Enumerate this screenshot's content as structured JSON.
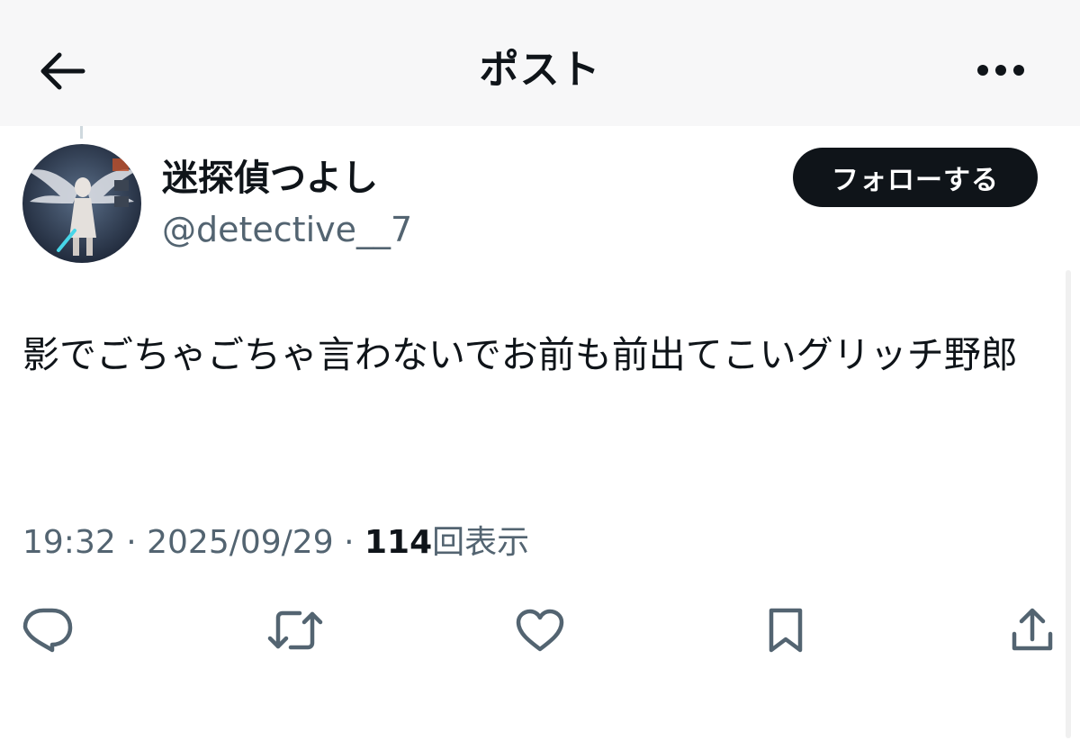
{
  "header": {
    "title": "ポスト",
    "back_icon": "arrow-left-icon",
    "more_icon": "more-horizontal-icon"
  },
  "author": {
    "display_name": "迷探偵つよし",
    "handle": "@detective__7",
    "follow_label": "フォローする"
  },
  "post": {
    "text": "影でごちゃごちゃ言わないでお前も前出てこいグリッチ野郎",
    "time": "19:32",
    "separator": "·",
    "date": "2025/09/29",
    "views_count": "114",
    "views_label": "回表示"
  },
  "actions": [
    {
      "name": "reply",
      "icon": "reply-icon"
    },
    {
      "name": "repost",
      "icon": "repost-icon"
    },
    {
      "name": "like",
      "icon": "heart-icon"
    },
    {
      "name": "bookmark",
      "icon": "bookmark-icon"
    },
    {
      "name": "share",
      "icon": "share-icon"
    }
  ],
  "colors": {
    "text_primary": "#0f1419",
    "text_secondary": "#536471",
    "header_bg": "#f7f7f8",
    "follow_bg": "#0f1419"
  }
}
